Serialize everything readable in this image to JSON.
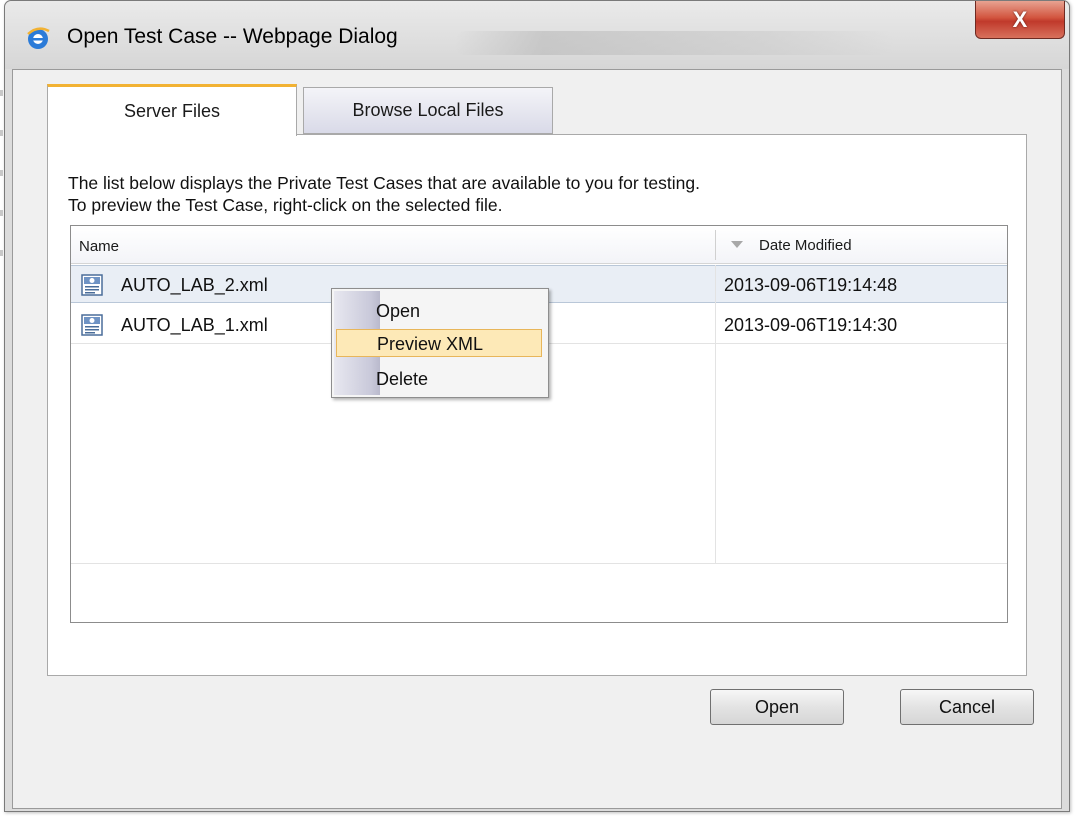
{
  "window": {
    "title": "Open Test Case -- Webpage Dialog",
    "close_glyph": "X"
  },
  "tabs": [
    {
      "label": "Server Files",
      "active": true
    },
    {
      "label": "Browse Local Files",
      "active": false
    }
  ],
  "description": {
    "line1": "The list below displays the Private Test Cases that are available to you for testing.",
    "line2": "To preview the Test Case, right-click on the selected file."
  },
  "list": {
    "columns": {
      "name": "Name",
      "date": "Date Modified"
    },
    "rows": [
      {
        "name": "AUTO_LAB_2.xml",
        "date": "2013-09-06T19:14:48",
        "selected": true
      },
      {
        "name": "AUTO_LAB_1.xml",
        "date": "2013-09-06T19:14:30",
        "selected": false
      }
    ]
  },
  "context_menu": {
    "items": [
      {
        "label": "Open"
      },
      {
        "label": "Preview XML",
        "highlighted": true
      },
      {
        "label": "Delete"
      }
    ]
  },
  "buttons": {
    "open": "Open",
    "cancel": "Cancel"
  },
  "colors": {
    "active_tab_accent": "#f2b233",
    "menu_highlight": "#fde9b7",
    "close_button": "#c0392b"
  },
  "icons": {
    "title": "ie-icon",
    "file": "xml-file-icon",
    "sort": "sort-desc-icon"
  }
}
